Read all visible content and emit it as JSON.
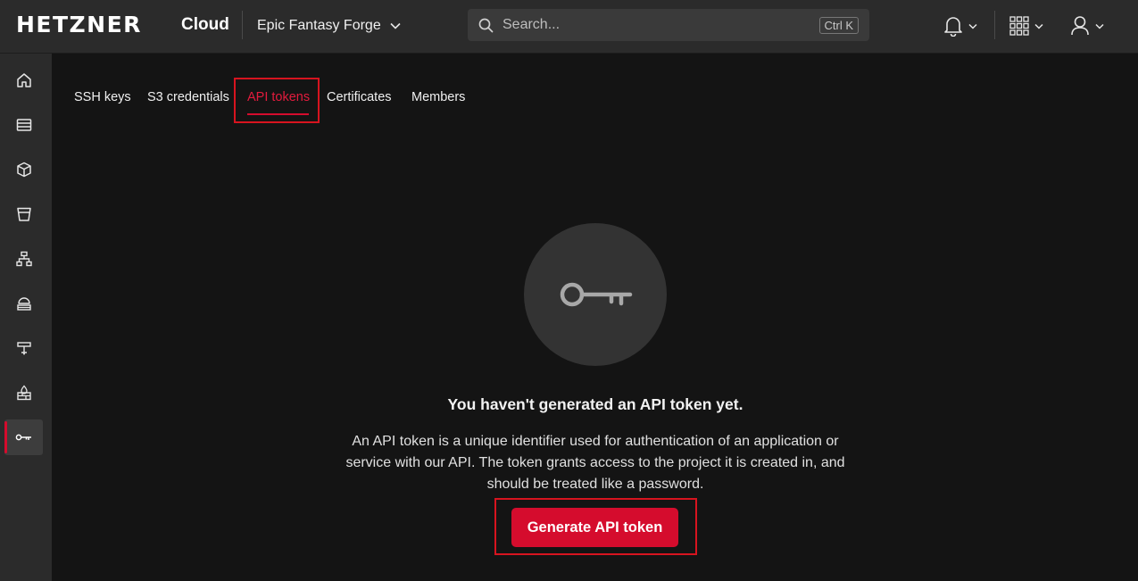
{
  "header": {
    "logo": "HETZNER",
    "logo_sub": "Cloud",
    "project_name": "Epic Fantasy Forge",
    "search_placeholder": "Search...",
    "search_shortcut": "Ctrl K"
  },
  "sidebar": {
    "items": [
      {
        "name": "home",
        "icon": "home-icon"
      },
      {
        "name": "servers",
        "icon": "server-icon"
      },
      {
        "name": "volumes",
        "icon": "cube-icon"
      },
      {
        "name": "storage",
        "icon": "bucket-icon"
      },
      {
        "name": "networks",
        "icon": "network-icon"
      },
      {
        "name": "load-balancers",
        "icon": "load-balancer-icon"
      },
      {
        "name": "floating-ips",
        "icon": "floating-ip-icon"
      },
      {
        "name": "firewalls",
        "icon": "firewall-icon"
      },
      {
        "name": "security",
        "icon": "key-icon",
        "active": true
      }
    ]
  },
  "tabs": [
    {
      "label": "SSH keys"
    },
    {
      "label": "S3 credentials"
    },
    {
      "label": "API tokens",
      "active": true
    },
    {
      "label": "Certificates"
    },
    {
      "label": "Members"
    }
  ],
  "empty_state": {
    "icon": "key-icon",
    "title": "You haven't generated an API token yet.",
    "description": "An API token is a unique identifier used for authentication of an application or service with our API. The token grants access to the project it is created in, and should be treated like a password.",
    "button_label": "Generate API token"
  },
  "colors": {
    "accent": "#d50c2d",
    "background": "#141414",
    "surface": "#2b2b2b"
  }
}
